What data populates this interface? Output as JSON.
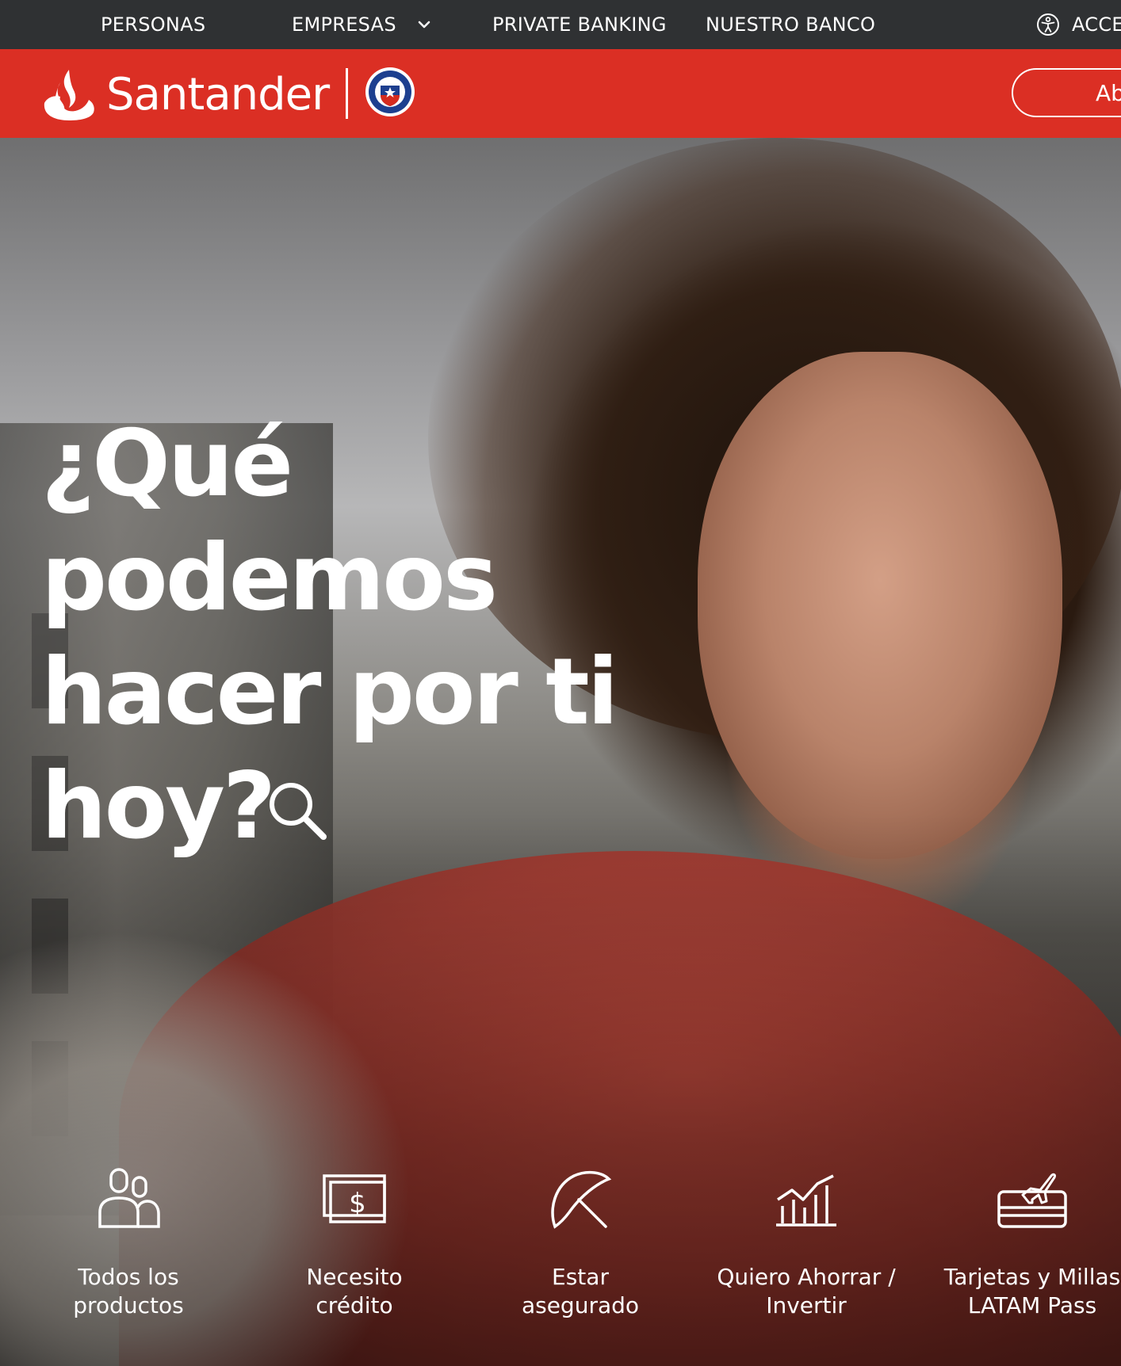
{
  "topnav": {
    "items": [
      {
        "label": "PERSONAS"
      },
      {
        "label": "EMPRESAS"
      },
      {
        "label": "PRIVATE BANKING"
      },
      {
        "label": "NUESTRO BANCO"
      },
      {
        "label": "ACCES"
      }
    ]
  },
  "header": {
    "brand": "Santander",
    "open_button_label": "Ab"
  },
  "hero": {
    "headline": [
      "¿Qué",
      "podemos",
      "hacer por ti",
      "hoy?"
    ]
  },
  "tiles": [
    {
      "icon": "users-icon",
      "lines": [
        "Todos los",
        "productos"
      ]
    },
    {
      "icon": "cash-icon",
      "lines": [
        "Necesito",
        "crédito"
      ]
    },
    {
      "icon": "umbrella-icon",
      "lines": [
        "Estar",
        "asegurado"
      ]
    },
    {
      "icon": "chart-icon",
      "lines": [
        "Quiero Ahorrar /",
        "Invertir"
      ]
    },
    {
      "icon": "card-plane-icon",
      "lines": [
        "Tarjetas y Millas",
        "LATAM Pass"
      ]
    }
  ],
  "colors": {
    "brand_red": "#db2f24",
    "topnav_bg": "#2f3133"
  }
}
